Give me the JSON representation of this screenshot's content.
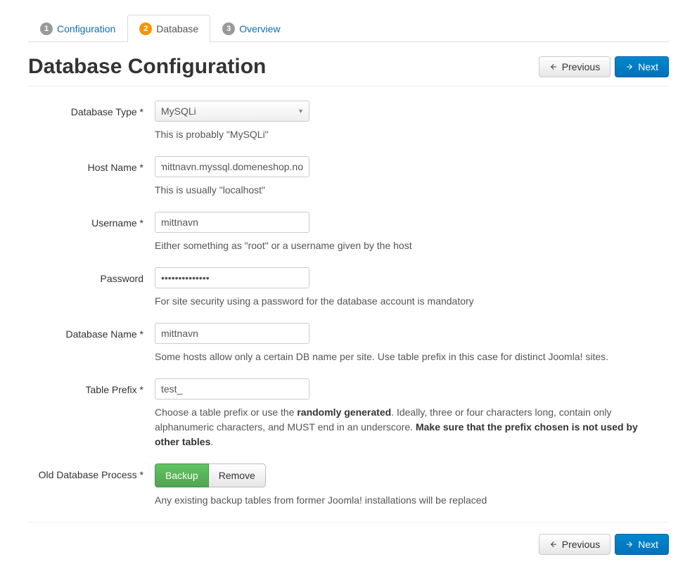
{
  "tabs": [
    {
      "num": "1",
      "label": "Configuration"
    },
    {
      "num": "2",
      "label": "Database"
    },
    {
      "num": "3",
      "label": "Overview"
    }
  ],
  "page_title": "Database Configuration",
  "buttons": {
    "previous": "Previous",
    "next": "Next"
  },
  "fields": {
    "db_type": {
      "label": "Database Type *",
      "value": "MySQLi",
      "help": "This is probably \"MySQLi\""
    },
    "host": {
      "label": "Host Name *",
      "value": "mittnavn.myssql.domeneshop.no",
      "help": "This is usually \"localhost\""
    },
    "username": {
      "label": "Username *",
      "value": "mittnavn",
      "help": "Either something as \"root\" or a username given by the host"
    },
    "password": {
      "label": "Password",
      "value": "••••••••••••••",
      "help": "For site security using a password for the database account is mandatory"
    },
    "db_name": {
      "label": "Database Name *",
      "value": "mittnavn",
      "help": "Some hosts allow only a certain DB name per site. Use table prefix in this case for distinct Joomla! sites."
    },
    "prefix": {
      "label": "Table Prefix *",
      "value": "test_",
      "help_pre": "Choose a table prefix or use the ",
      "help_b1": "randomly generated",
      "help_mid": ". Ideally, three or four characters long, contain only alphanumeric characters, and MUST end in an underscore. ",
      "help_b2": "Make sure that the prefix chosen is not used by other tables",
      "help_post": "."
    },
    "old_db": {
      "label": "Old Database Process *",
      "option_backup": "Backup",
      "option_remove": "Remove",
      "help": "Any existing backup tables from former Joomla! installations will be replaced"
    }
  }
}
